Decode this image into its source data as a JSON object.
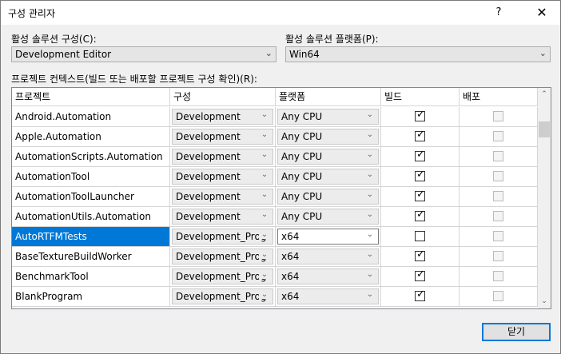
{
  "window": {
    "title": "구성 관리자",
    "help_glyph": "?",
    "close_glyph": "✕"
  },
  "active_config": {
    "label": "활성 솔루션 구성(C):",
    "value": "Development Editor"
  },
  "active_platform": {
    "label": "활성 솔루션 플랫폼(P):",
    "value": "Win64"
  },
  "grid_caption": "프로젝트 컨텍스트(빌드 또는 배포할 프로젝트 구성 확인)(R):",
  "columns": [
    "프로젝트",
    "구성",
    "플랫폼",
    "빌드",
    "배포"
  ],
  "rows": [
    {
      "project": "Android.Automation",
      "config": "Development",
      "platform": "Any CPU",
      "build": true,
      "deploy": false,
      "selected": false
    },
    {
      "project": "Apple.Automation",
      "config": "Development",
      "platform": "Any CPU",
      "build": true,
      "deploy": false,
      "selected": false
    },
    {
      "project": "AutomationScripts.Automation",
      "config": "Development",
      "platform": "Any CPU",
      "build": true,
      "deploy": false,
      "selected": false
    },
    {
      "project": "AutomationTool",
      "config": "Development",
      "platform": "Any CPU",
      "build": true,
      "deploy": false,
      "selected": false
    },
    {
      "project": "AutomationToolLauncher",
      "config": "Development",
      "platform": "Any CPU",
      "build": true,
      "deploy": false,
      "selected": false
    },
    {
      "project": "AutomationUtils.Automation",
      "config": "Development",
      "platform": "Any CPU",
      "build": true,
      "deploy": false,
      "selected": false
    },
    {
      "project": "AutoRTFMTests",
      "config": "Development_Prog",
      "platform": "x64",
      "build": false,
      "deploy": false,
      "selected": true
    },
    {
      "project": "BaseTextureBuildWorker",
      "config": "Development_Prog",
      "platform": "x64",
      "build": true,
      "deploy": false,
      "selected": false
    },
    {
      "project": "BenchmarkTool",
      "config": "Development_Prog",
      "platform": "x64",
      "build": true,
      "deploy": false,
      "selected": false
    },
    {
      "project": "BlankProgram",
      "config": "Development_Prog",
      "platform": "x64",
      "build": true,
      "deploy": false,
      "selected": false
    }
  ],
  "close_button": "닫기",
  "icons": {
    "dropdown": "chevron-down-icon",
    "check": "checkmark-icon"
  },
  "colors": {
    "selection": "#0078d7",
    "focus_border": "#0078d7"
  }
}
